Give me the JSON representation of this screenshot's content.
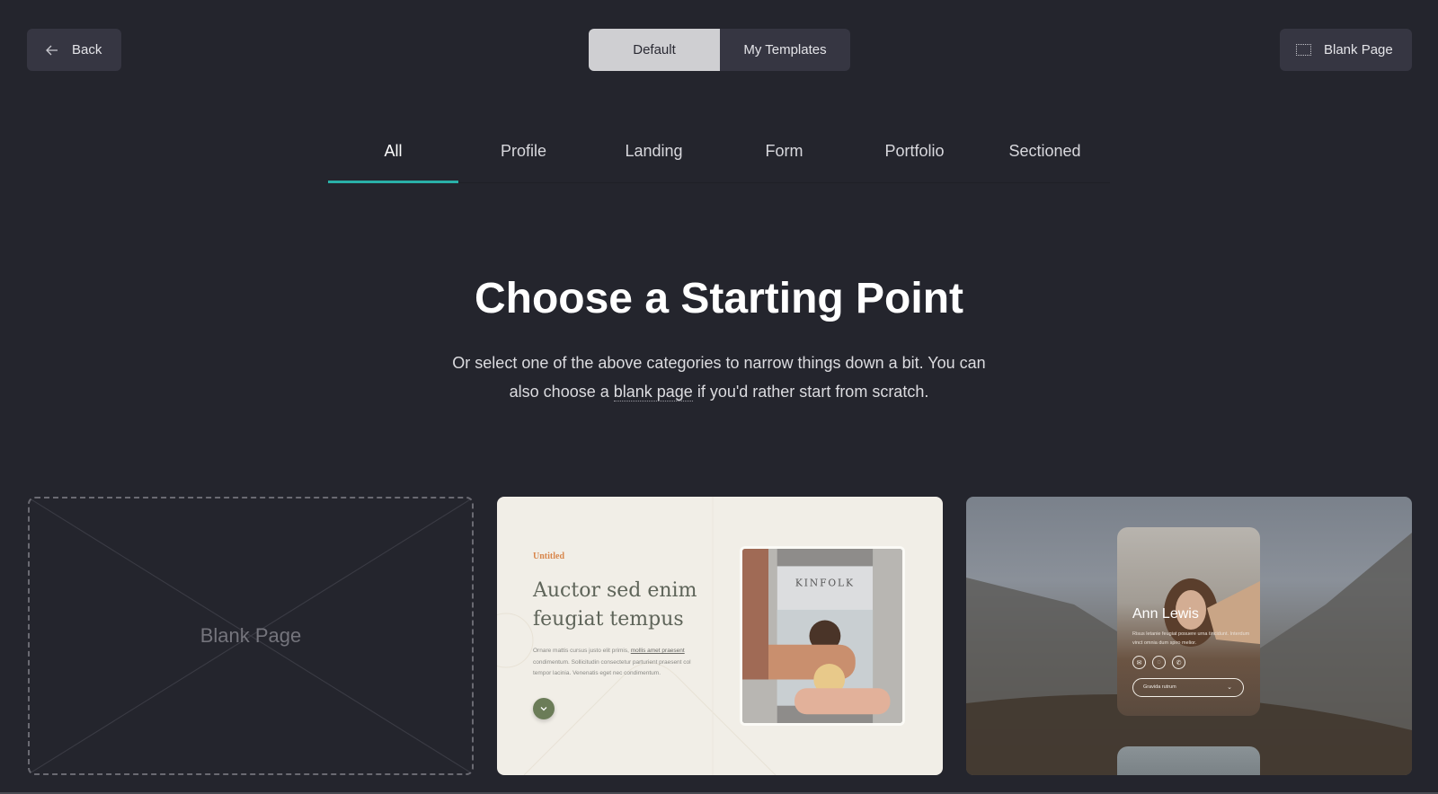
{
  "header": {
    "back_label": "Back",
    "back_icon": "arrow-left-icon",
    "segments": [
      {
        "label": "Default",
        "active": true
      },
      {
        "label": "My Templates",
        "active": false
      }
    ],
    "blank_page_label": "Blank Page",
    "blank_page_icon": "dashed-rectangle-icon"
  },
  "categories": {
    "tabs": [
      {
        "label": "All",
        "active": true
      },
      {
        "label": "Profile",
        "active": false
      },
      {
        "label": "Landing",
        "active": false
      },
      {
        "label": "Form",
        "active": false
      },
      {
        "label": "Portfolio",
        "active": false
      },
      {
        "label": "Sectioned",
        "active": false
      }
    ],
    "accent_color": "#2ab0a8"
  },
  "hero": {
    "title": "Choose a Starting Point",
    "subtitle_before": "Or select one of the above categories to narrow things down a bit. You can also choose a ",
    "subtitle_link": "blank page",
    "subtitle_after": " if you'd rather start from scratch."
  },
  "templates": {
    "blank": {
      "label": "Blank Page"
    },
    "landing": {
      "kicker": "Untitled",
      "title": "Auctor sed enim feugiat tempus",
      "body_before": "Ornare mattis cursus justo elit primis, ",
      "body_link": "mollis amet praesent",
      "body_after": " condimentum. Sollicitudin consectetur parturient praesent col tempor lacinia. Venenatis eget nec condimentum.",
      "photo_caption": "KINFOLK",
      "down_icon": "chevron-down-icon"
    },
    "profile": {
      "name": "Ann Lewis",
      "description": "Risus letanie feugiat posuere urna tincidunt. Interdum vinct omnia dum spiro melior.",
      "icons": [
        "mail-icon",
        "chat-icon",
        "phone-icon"
      ],
      "select_label": "Gravida rutrum"
    }
  }
}
